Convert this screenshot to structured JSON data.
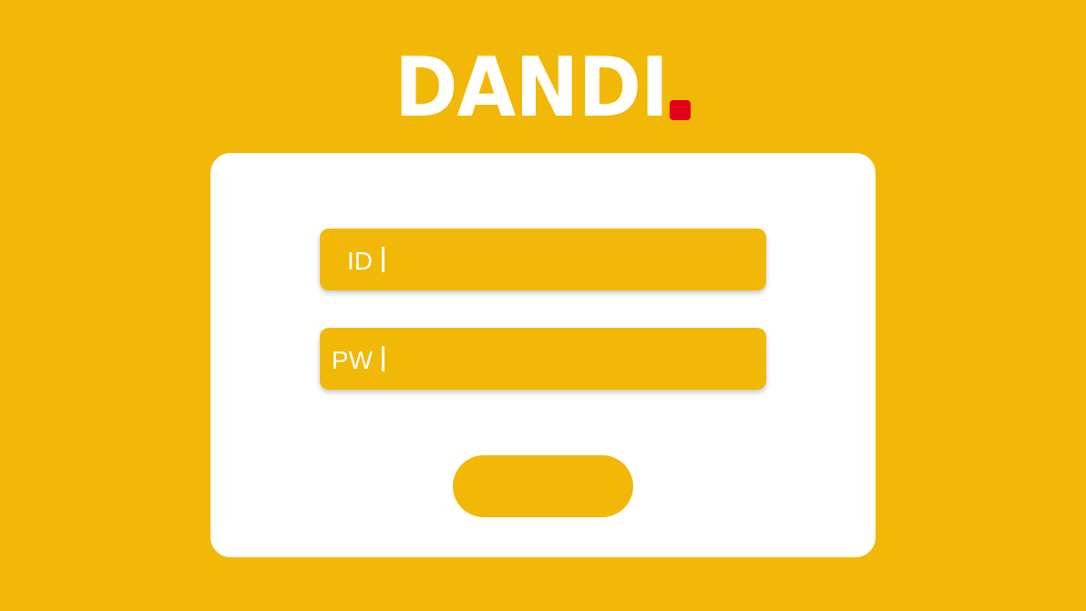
{
  "brand": {
    "logo_text": "DANDI",
    "accent_color": "#E3001B",
    "background_color": "#F2B807"
  },
  "login_form": {
    "id_label": "ID",
    "id_value": "",
    "id_placeholder": "",
    "pw_label": "PW",
    "pw_value": "",
    "pw_placeholder": "",
    "submit_label": ""
  }
}
